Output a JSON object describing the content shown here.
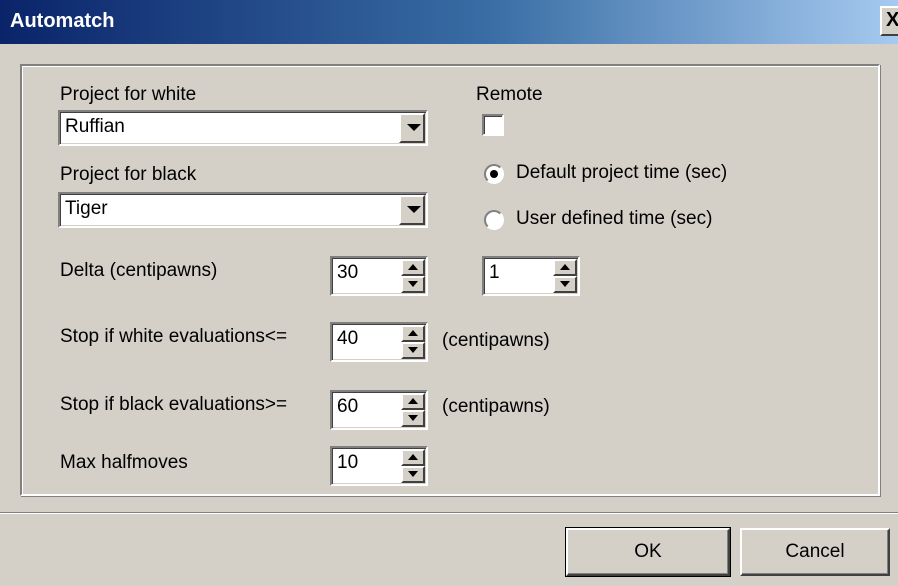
{
  "window": {
    "title": "Automatch",
    "close_glyph": "X"
  },
  "fields": {
    "project_white": {
      "label": "Project for white",
      "value": "Ruffian"
    },
    "project_black": {
      "label": "Project for black",
      "value": "Tiger"
    },
    "remote": {
      "label": "Remote",
      "checked": false
    },
    "time_mode": {
      "options": [
        {
          "label": "Default project time (sec)",
          "selected": true
        },
        {
          "label": "User defined time (sec)",
          "selected": false
        }
      ]
    },
    "user_time": {
      "value": "1"
    },
    "delta": {
      "label": "Delta (centipawns)",
      "value": "30"
    },
    "stop_white": {
      "label": "Stop if white evaluations<=",
      "value": "40",
      "unit": "(centipawns)"
    },
    "stop_black": {
      "label": "Stop if black evaluations>=",
      "value": "60",
      "unit": "(centipawns)"
    },
    "max_halfmoves": {
      "label": "Max halfmoves",
      "value": "10"
    }
  },
  "buttons": {
    "ok": "OK",
    "cancel": "Cancel"
  }
}
